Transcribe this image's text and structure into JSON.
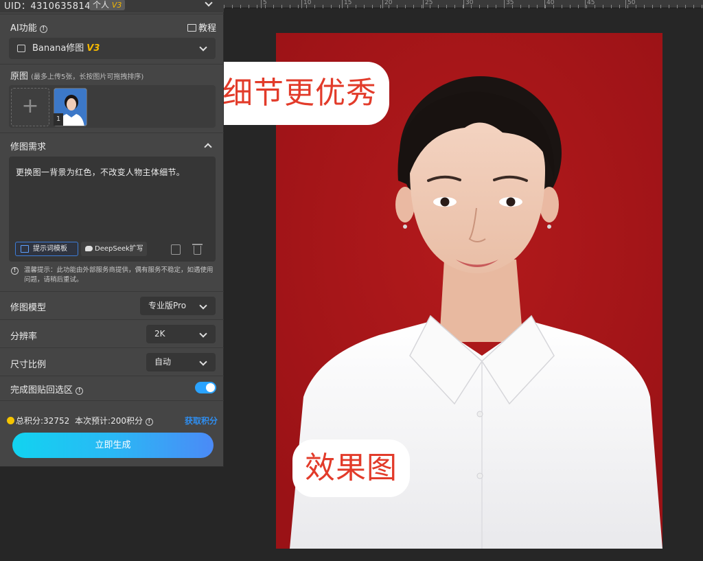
{
  "header": {
    "uid": "UID：4310635814",
    "user_type": "个人",
    "user_version": "V3"
  },
  "function_section": {
    "title": "AI功能",
    "tutorial_label": "教程",
    "selected_function": "Banana修图",
    "function_version": "V3"
  },
  "source_section": {
    "title": "原图",
    "hint": "(最多上传5张，长按图片可拖拽排序)",
    "upload_symbol": "+",
    "images": [
      {
        "index": "1"
      }
    ]
  },
  "requirement_section": {
    "title": "修图需求",
    "text": "更换图一背景为红色，不改变人物主体细节。",
    "template_button": "提示词模板",
    "deepseek_button": "DeepSeek扩写",
    "notice": "温馨提示：此功能由外部服务商提供，偶有服务不稳定，如遇使用问题，请稍后重试。"
  },
  "options": {
    "model_label": "修图模型",
    "model_value": "专业版Pro",
    "resolution_label": "分辨率",
    "resolution_value": "2K",
    "ratio_label": "尺寸比例",
    "ratio_value": "自动",
    "paste_back_label": "完成图贴回选区",
    "paste_back_enabled": true
  },
  "footer": {
    "total_points": "总积分:32752",
    "estimate": "本次预计:200积分",
    "get_points": "获取积分",
    "generate_button": "立即生成"
  },
  "canvas": {
    "ruler_numbers": [
      "5",
      "10",
      "15",
      "20",
      "25",
      "30",
      "35",
      "40",
      "45",
      "50"
    ],
    "sticker_top": "边缘细节更优秀",
    "sticker_bottom": "效果图",
    "background_color": "#a8161a"
  }
}
